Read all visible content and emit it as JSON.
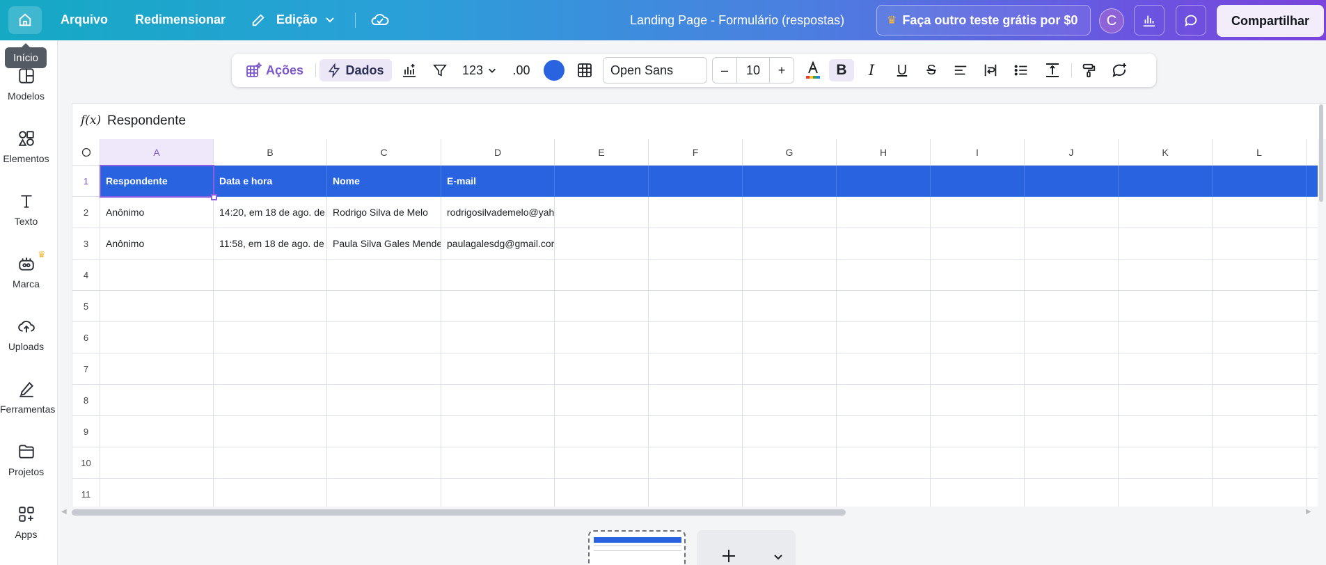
{
  "topbar": {
    "menu": [
      "Arquivo",
      "Redimensionar",
      "Edição"
    ],
    "doc_title": "Landing Page - Formulário (respostas)",
    "trial": "Faça outro teste grátis por $0",
    "avatar_initial": "C",
    "share": "Compartilhar"
  },
  "tooltip": "Início",
  "sidebar": {
    "items": [
      "Modelos",
      "Elementos",
      "Texto",
      "Marca",
      "Uploads",
      "Ferramentas",
      "Projetos",
      "Apps"
    ]
  },
  "toolbar": {
    "acoes": "Ações",
    "dados": "Dados",
    "number_format": "123",
    "decimals": ".00",
    "font": "Open Sans",
    "font_size": "10",
    "minus": "–",
    "plus": "+",
    "accent_color": "#2a63e0"
  },
  "formula": {
    "fx": "f(x)",
    "value": "Respondente"
  },
  "grid": {
    "columns": [
      "A",
      "B",
      "C",
      "D",
      "E",
      "F",
      "G",
      "H",
      "I",
      "J",
      "K",
      "L"
    ],
    "rows": [
      "1",
      "2",
      "3",
      "4",
      "5",
      "6",
      "7",
      "8",
      "9",
      "10",
      "11"
    ],
    "header_row": [
      "Respondente",
      "Data e hora",
      "Nome",
      "E-mail"
    ],
    "data": [
      [
        "Anônimo",
        "14:20, em 18 de ago. de",
        "Rodrigo  Silva de Melo",
        "rodrigosilvademelo@yah"
      ],
      [
        "Anônimo",
        "11:58, em 18 de ago. de",
        "Paula Silva Gales Mende",
        "paulagalesdg@gmail.con"
      ]
    ],
    "selected_cell": "A1"
  },
  "colors": {
    "header_fill": "#2a63e0",
    "selection": "#8a5ee0"
  }
}
